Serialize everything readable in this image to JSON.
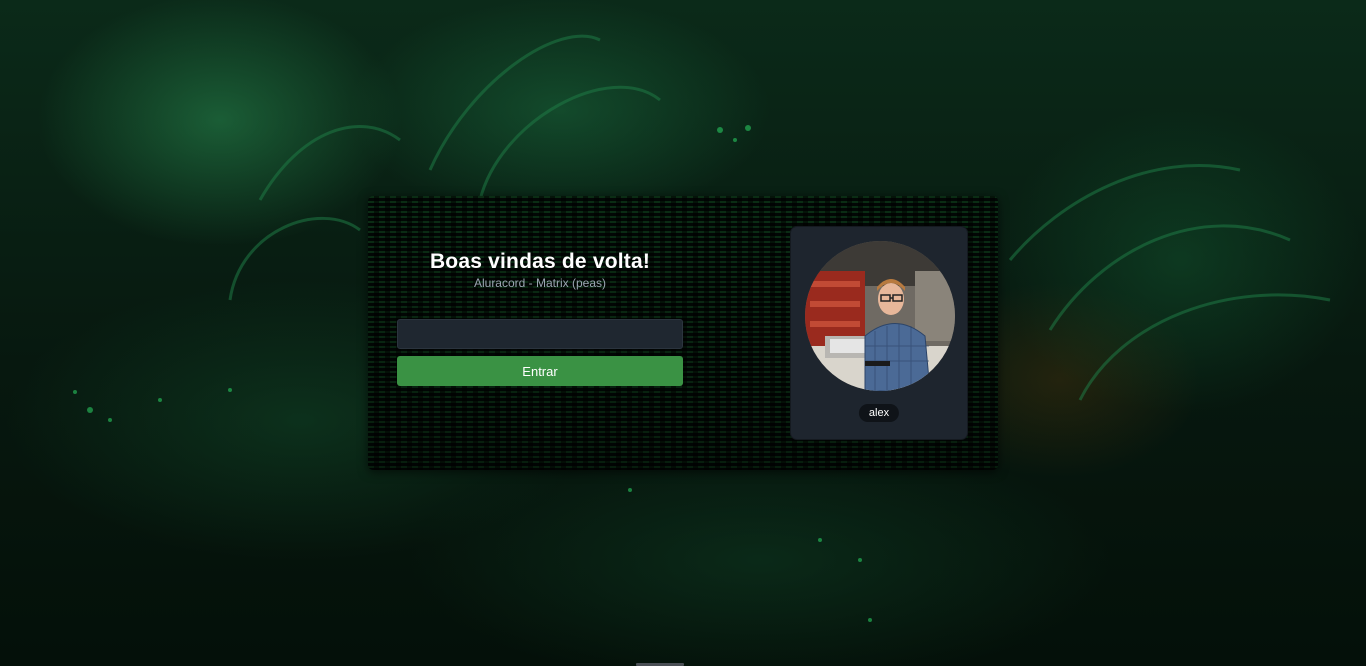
{
  "login": {
    "title": "Boas vindas de volta!",
    "subtitle": "Aluracord - Matrix (peas)",
    "username_value": "",
    "submit_label": "Entrar"
  },
  "profile": {
    "username": "alex"
  },
  "colors": {
    "button_green": "#3a9244",
    "panel_bg": "#1e252e",
    "input_bg": "#1f2730"
  }
}
